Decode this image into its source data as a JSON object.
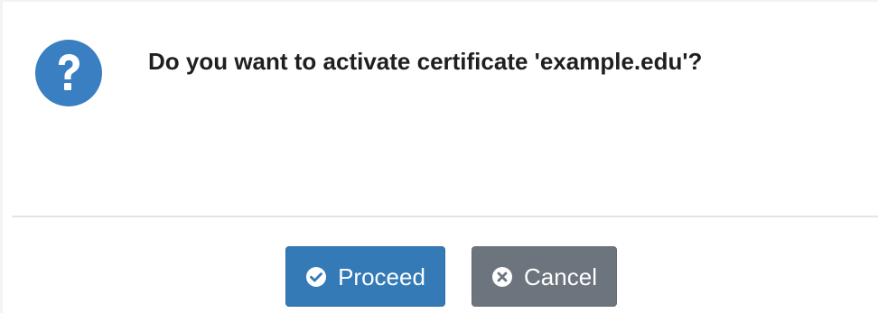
{
  "dialog": {
    "icon": "question-circle-icon",
    "message": "Do you want to activate certificate 'example.edu'?",
    "buttons": {
      "proceed": {
        "label": "Proceed",
        "icon": "check-circle-icon",
        "color": "#337ab7"
      },
      "cancel": {
        "label": "Cancel",
        "icon": "times-circle-icon",
        "color": "#6c757d"
      }
    }
  },
  "colors": {
    "question_icon": "#3a7fc1",
    "text": "#1f1f1f",
    "divider": "#e4e4e4"
  }
}
